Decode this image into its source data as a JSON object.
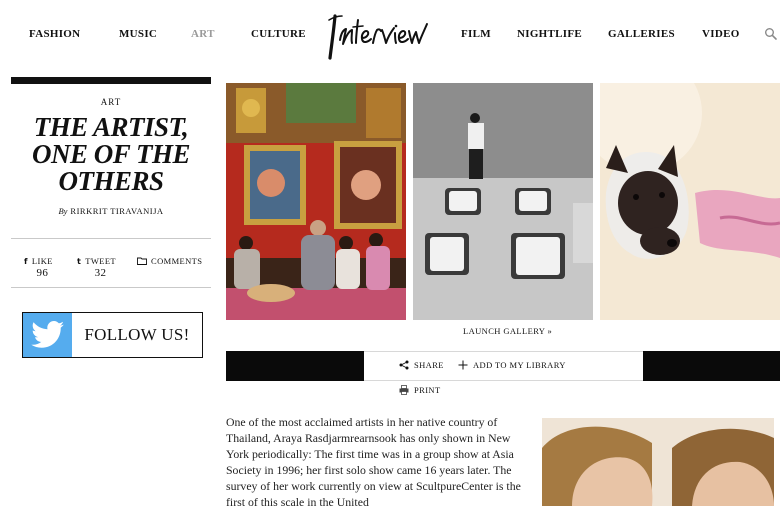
{
  "nav": {
    "items": [
      {
        "label": "FASHION"
      },
      {
        "label": "MUSIC"
      },
      {
        "label": "ART",
        "active": true
      },
      {
        "label": "CULTURE"
      },
      {
        "label": "FILM"
      },
      {
        "label": "NIGHTLIFE"
      },
      {
        "label": "GALLERIES"
      },
      {
        "label": "VIDEO"
      }
    ],
    "logo_text": "Interview",
    "search_icon": "search-icon"
  },
  "article": {
    "category": "ART",
    "title_lines": [
      "THE ARTIST,",
      "ONE OF THE",
      "OTHERS"
    ],
    "by": "By",
    "author": "RIRKRIT TIRAVANIJA",
    "body": "One of the most acclaimed artists in her native country of Thailand, Araya Rasdjarmrearnsook has only shown in New York periodically: The first time was in a group show at Asia Society in 1996; her first solo show came 16 years later. The survey of her work currently on view at ScultpureCenter is the first of this scale in the United"
  },
  "social": {
    "like_label": "LIKE",
    "like_count": "96",
    "tweet_label": "TWEET",
    "tweet_count": "32",
    "comments_label": "COMMENTS"
  },
  "follow": {
    "label": "FOLLOW US!",
    "color": "#55acee"
  },
  "gallery": {
    "launch_label": "LAUNCH GALLERY »",
    "photos": [
      "temple-paintings-photo",
      "figures-on-mats-photo",
      "dog-with-cone-photo"
    ]
  },
  "actions": {
    "share_label": "SHARE",
    "library_label": "ADD TO MY LIBRARY",
    "print_label": "PRINT"
  }
}
